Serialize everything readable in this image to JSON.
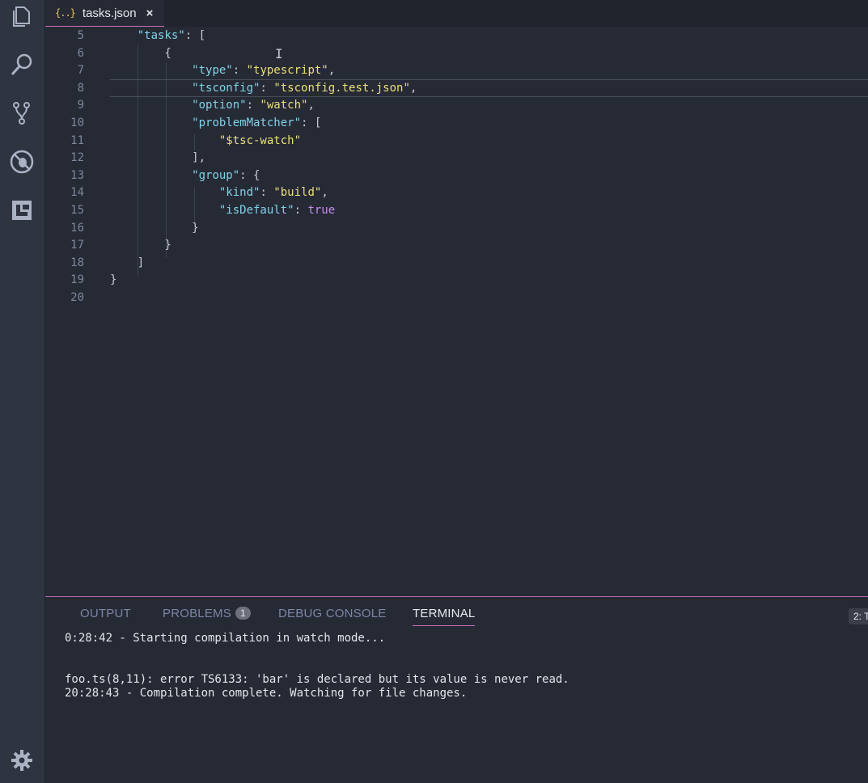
{
  "tab": {
    "icon": "{..}",
    "label": "tasks.json",
    "close": "×"
  },
  "editor": {
    "lines": [
      {
        "n": "5",
        "code": [
          [
            "p",
            "    "
          ],
          [
            "k",
            "\"tasks\""
          ],
          [
            "p",
            ": ["
          ]
        ]
      },
      {
        "n": "6",
        "code": [
          [
            "p",
            "        {"
          ]
        ]
      },
      {
        "n": "7",
        "code": [
          [
            "p",
            "            "
          ],
          [
            "k",
            "\"type\""
          ],
          [
            "p",
            ": "
          ],
          [
            "s",
            "\"typescript\""
          ],
          [
            "p",
            ","
          ]
        ]
      },
      {
        "n": "8",
        "code": [
          [
            "p",
            "            "
          ],
          [
            "k",
            "\"tsconfig\""
          ],
          [
            "p",
            ": "
          ],
          [
            "s",
            "\"tsconfig.test.json\""
          ],
          [
            "p",
            ","
          ]
        ],
        "active": true
      },
      {
        "n": "9",
        "code": [
          [
            "p",
            "            "
          ],
          [
            "k",
            "\"option\""
          ],
          [
            "p",
            ": "
          ],
          [
            "s",
            "\"watch\""
          ],
          [
            "p",
            ","
          ]
        ]
      },
      {
        "n": "10",
        "code": [
          [
            "p",
            "            "
          ],
          [
            "k",
            "\"problemMatcher\""
          ],
          [
            "p",
            ": ["
          ]
        ]
      },
      {
        "n": "11",
        "code": [
          [
            "p",
            "                "
          ],
          [
            "s",
            "\"$tsc-watch\""
          ]
        ]
      },
      {
        "n": "12",
        "code": [
          [
            "p",
            "            ],"
          ]
        ]
      },
      {
        "n": "13",
        "code": [
          [
            "p",
            "            "
          ],
          [
            "k",
            "\"group\""
          ],
          [
            "p",
            ": {"
          ]
        ]
      },
      {
        "n": "14",
        "code": [
          [
            "p",
            "                "
          ],
          [
            "k",
            "\"kind\""
          ],
          [
            "p",
            ": "
          ],
          [
            "s",
            "\"build\""
          ],
          [
            "p",
            ","
          ]
        ]
      },
      {
        "n": "15",
        "code": [
          [
            "p",
            "                "
          ],
          [
            "k",
            "\"isDefault\""
          ],
          [
            "p",
            ": "
          ],
          [
            "b",
            "true"
          ]
        ]
      },
      {
        "n": "16",
        "code": [
          [
            "p",
            "            }"
          ]
        ]
      },
      {
        "n": "17",
        "code": [
          [
            "p",
            "        }"
          ]
        ]
      },
      {
        "n": "18",
        "code": [
          [
            "p",
            "    ]"
          ]
        ]
      },
      {
        "n": "19",
        "code": [
          [
            "p",
            "}"
          ]
        ]
      },
      {
        "n": "20",
        "code": []
      }
    ]
  },
  "panel": {
    "tabs": [
      {
        "label": "OUTPUT"
      },
      {
        "label": "PROBLEMS",
        "badge": "1"
      },
      {
        "label": "DEBUG CONSOLE"
      },
      {
        "label": "TERMINAL",
        "active": true
      }
    ],
    "dropdown": "2: T",
    "terminal": [
      "0:28:42 - Starting compilation in watch mode...",
      "foo.ts(8,11): error TS6133: 'bar' is declared but its value is never read.",
      "20:28:43 - Compilation complete. Watching for file changes."
    ]
  },
  "activity_icons": [
    "explorer-icon",
    "search-icon",
    "source-control-icon",
    "debug-icon",
    "extensions-icon",
    "gear-icon"
  ],
  "colors": {
    "accent": "#c86fb8",
    "string": "#ecdf7a",
    "key": "#80d3e8",
    "boolean": "#c68cf0"
  }
}
